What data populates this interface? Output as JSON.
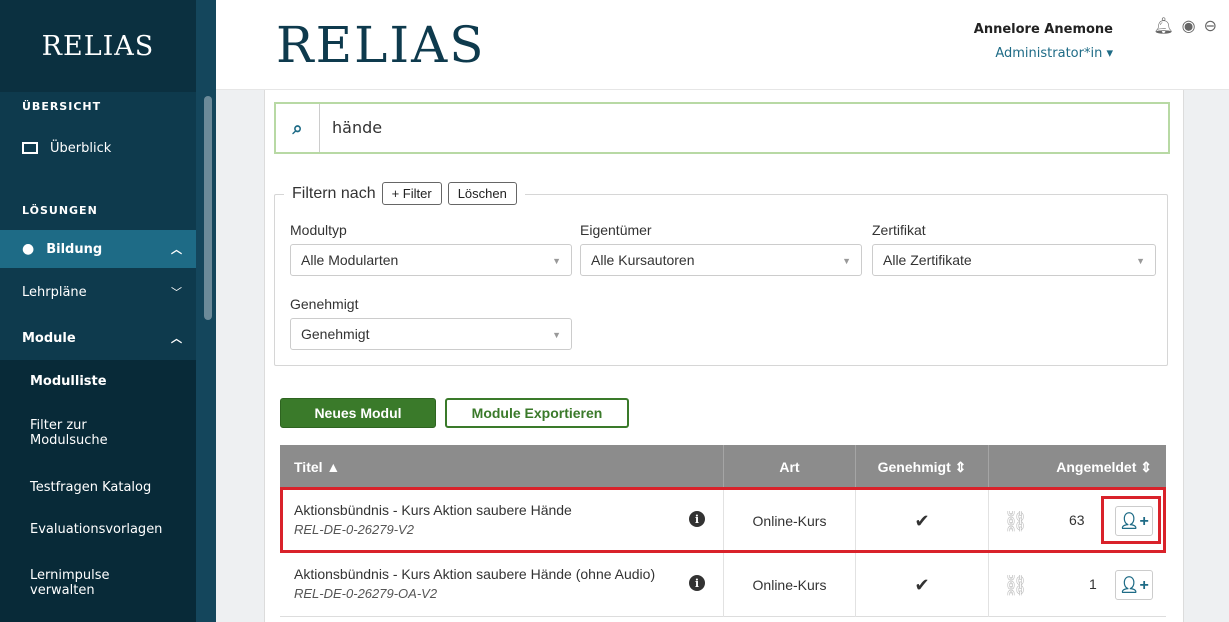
{
  "sidebar": {
    "logo": "RELIAS",
    "section_overview": "ÜBERSICHT",
    "item_overview": "Überblick",
    "section_solutions": "LÖSUNGEN",
    "item_education": "Bildung",
    "item_curricula": "Lehrpläne",
    "item_modules": "Module",
    "sub_items": [
      "Modulliste",
      "Filter zur\nModulsuche",
      "Testfragen Katalog",
      "Evaluationsvorlagen",
      "Lernimpulse\nverwalten"
    ]
  },
  "header": {
    "logo": "RELIAS",
    "user_name": "Annelore Anemone",
    "role": "Administrator*in"
  },
  "search": {
    "value": "hände"
  },
  "filter": {
    "legend": "Filtern nach",
    "add_filter": "+ Filter",
    "clear": "Löschen",
    "modultyp_label": "Modultyp",
    "modultyp_value": "Alle Modularten",
    "owner_label": "Eigentümer",
    "owner_value": "Alle Kursautoren",
    "certificate_label": "Zertifikat",
    "certificate_value": "Alle Zertifikate",
    "approved_label": "Genehmigt",
    "approved_value": "Genehmigt"
  },
  "actions": {
    "new_module": "Neues Modul",
    "export_modules": "Module Exportieren"
  },
  "table": {
    "headers": {
      "title": "Titel ▲",
      "type": "Art",
      "approved": "Genehmigt ⇕",
      "enrolled": "Angemeldet ⇕"
    },
    "rows": [
      {
        "title": "Aktionsbündnis - Kurs Aktion saubere Hände",
        "code": "REL-DE-0-26279-V2",
        "type": "Online-Kurs",
        "approved": "✔",
        "count": "63"
      },
      {
        "title": "Aktionsbündnis - Kurs Aktion saubere Hände (ohne Audio)",
        "code": "REL-DE-0-26279-OA-V2",
        "type": "Online-Kurs",
        "approved": "✔",
        "count": "1"
      }
    ]
  },
  "colors": {
    "sidebar": "#0e3a4d",
    "accent_green": "#3a7a2a",
    "highlight": "#d9222a",
    "teal": "#1e6b86"
  }
}
